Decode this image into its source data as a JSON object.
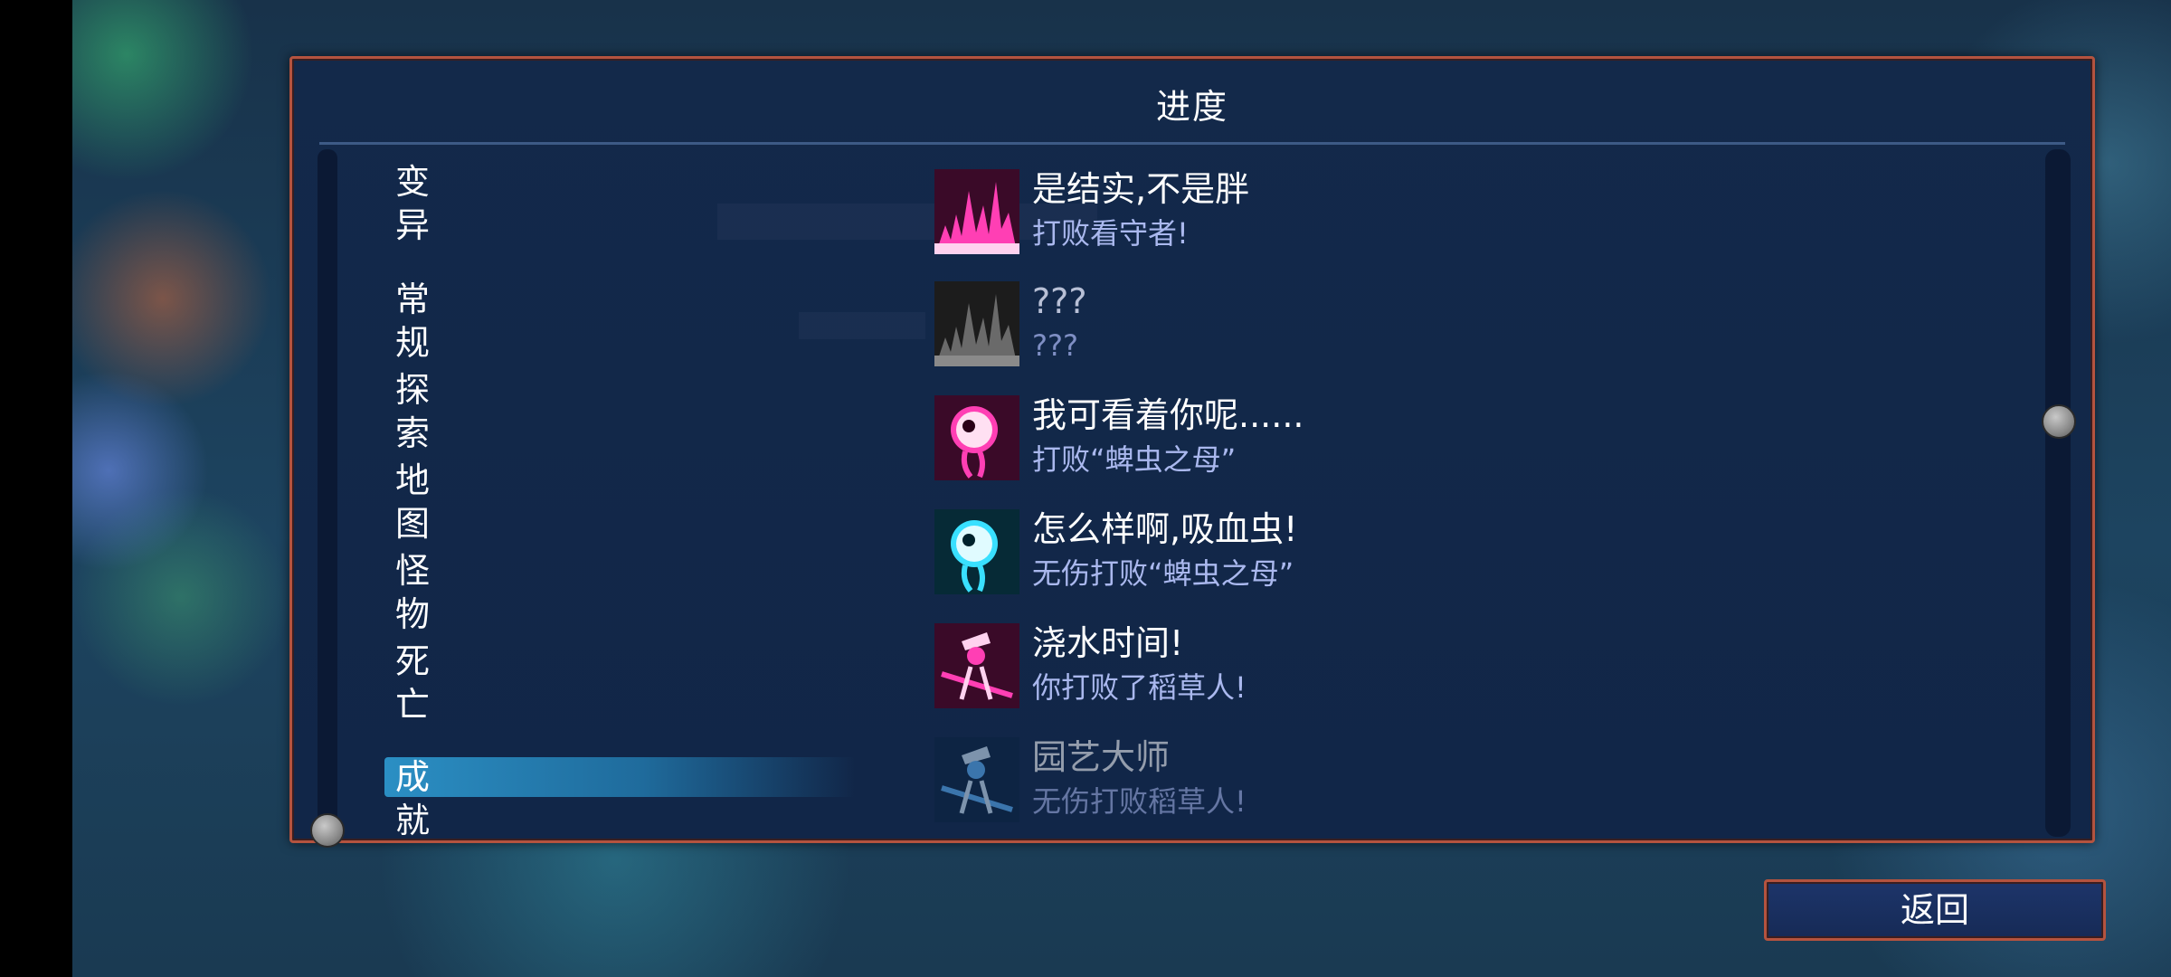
{
  "panel": {
    "title": "进度"
  },
  "categories": [
    {
      "label": "变异",
      "selected": false
    },
    {
      "label": "常规",
      "selected": false
    },
    {
      "label": "探索",
      "selected": false
    },
    {
      "label": "地图",
      "selected": false
    },
    {
      "label": "怪物",
      "selected": false
    },
    {
      "label": "死亡",
      "selected": false
    },
    {
      "label": "成就",
      "selected": true
    }
  ],
  "achievements": [
    {
      "title": "是结实,不是胖",
      "description": "打败看守者!",
      "icon": "pink-spikes-icon",
      "state": "unlocked"
    },
    {
      "title": "???",
      "description": "???",
      "icon": "gray-spikes-icon",
      "state": "locked"
    },
    {
      "title": "我可看着你呢......",
      "description": "打败“蜱虫之母”",
      "icon": "pink-eyeball-icon",
      "state": "unlocked"
    },
    {
      "title": "怎么样啊,吸血虫!",
      "description": "无伤打败“蜱虫之母”",
      "icon": "cyan-eyeball-icon",
      "state": "unlocked"
    },
    {
      "title": "浇水时间!",
      "description": "你打败了稻草人!",
      "icon": "pink-scarecrow-icon",
      "state": "unlocked"
    },
    {
      "title": "园艺大师",
      "description": "无伤打败稻草人!",
      "icon": "blue-scarecrow-icon",
      "state": "partial"
    }
  ],
  "buttons": {
    "back": "返回"
  },
  "colors": {
    "panel_border": "#b4533f",
    "panel_bg": "#13294a",
    "selected_highlight": "#2b8fc4",
    "description_text": "#aab8ee",
    "pink_icon": "#ff3fb4",
    "cyan_icon": "#39e0ff"
  }
}
